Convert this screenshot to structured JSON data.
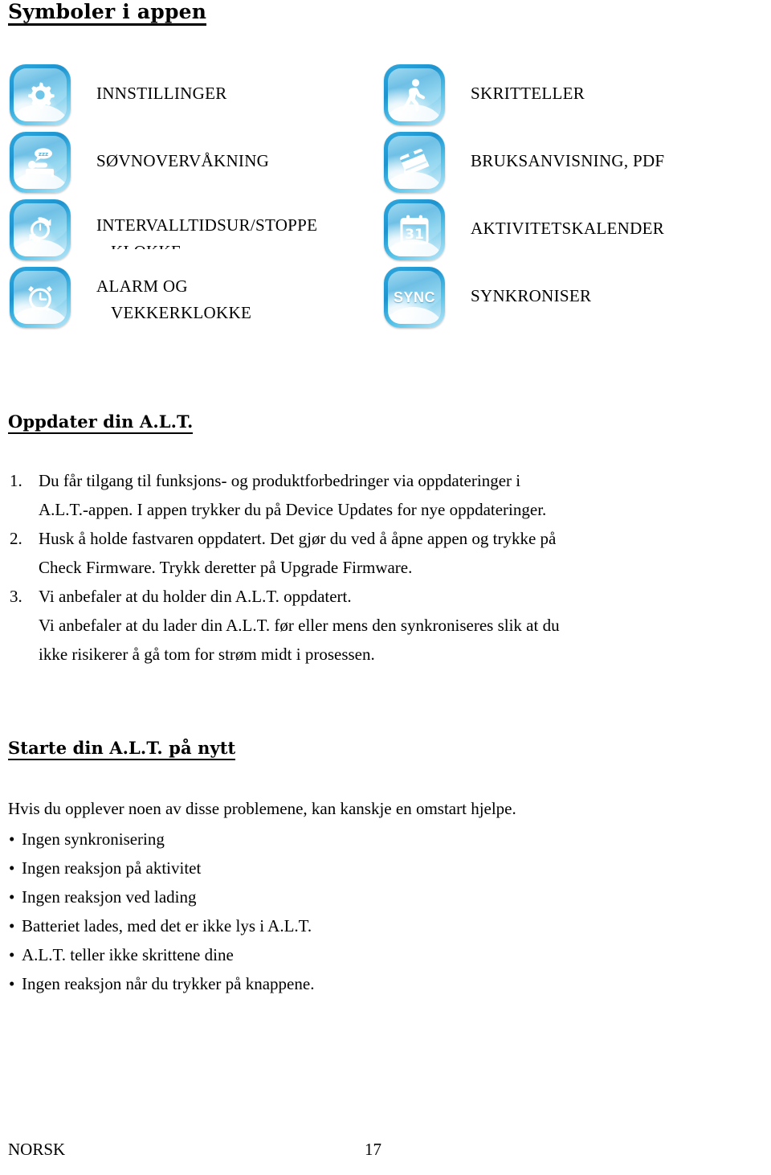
{
  "page": {
    "title": "Symboler i appen"
  },
  "symbols": {
    "left": [
      {
        "icon": "settings-gear-icon",
        "label": "INNSTILLINGER"
      },
      {
        "icon": "sleep-monitoring-icon",
        "label": "SØVNOVERVÅKNING"
      },
      {
        "icon": "interval-timer-stopwatch-icon",
        "label": "INTERVALLTIDSUR/STOPPE",
        "label_line2": "KLOKKE"
      },
      {
        "icon": "alarm-clock-icon",
        "label": "ALARM OG",
        "label_line2": "VEKKERKLOKKE"
      }
    ],
    "right": [
      {
        "icon": "pedometer-walking-icon",
        "label": "SKRITTELLER"
      },
      {
        "icon": "manual-book-icon",
        "label": "BRUKSANVISNING, PDF"
      },
      {
        "icon": "activity-calendar-icon",
        "label": "AKTIVITETSKALENDER",
        "glyph_text": "31"
      },
      {
        "icon": "sync-icon",
        "label": "SYNKRONISER",
        "glyph_text": "SYNC"
      }
    ]
  },
  "update_section": {
    "heading": "Oppdater din A.L.T.",
    "items": [
      {
        "number": "1.",
        "line1": "Du får tilgang til funksjons- og produktforbedringer via oppdateringer i",
        "line2": "A.L.T.-appen. I appen trykker du på Device Updates for nye oppdateringer."
      },
      {
        "number": "2.",
        "line1": "Husk å holde fastvaren oppdatert. Det gjør du ved å åpne appen og trykke på",
        "line2": "Check Firmware. Trykk deretter på Upgrade Firmware."
      },
      {
        "number": "3.",
        "line1": "Vi anbefaler at du holder din A.L.T. oppdatert.",
        "line2": "Vi anbefaler at du lader din A.L.T. før eller mens den synkroniseres slik at du",
        "line3": "ikke risikerer å gå tom for strøm midt i prosessen."
      }
    ]
  },
  "restart_section": {
    "heading": "Starte din A.L.T. på nytt",
    "intro": "Hvis du opplever noen av disse problemene, kan kanskje en omstart hjelpe.",
    "bullet_marker": "•",
    "bullets": [
      "Ingen synkronisering",
      "Ingen reaksjon på aktivitet",
      "Ingen reaksjon ved lading",
      "Batteriet lades, med det er ikke lys i A.L.T.",
      "A.L.T. teller ikke skrittene dine",
      "Ingen reaksjon når du trykker på knappene."
    ]
  },
  "footer": {
    "language": "NORSK",
    "page_number": "17"
  },
  "colors": {
    "icon_blue_dark": "#1d93cf",
    "icon_blue_mid": "#4fb9e4",
    "icon_blue_light": "#d8eefa",
    "text": "#000000",
    "background": "#ffffff"
  }
}
